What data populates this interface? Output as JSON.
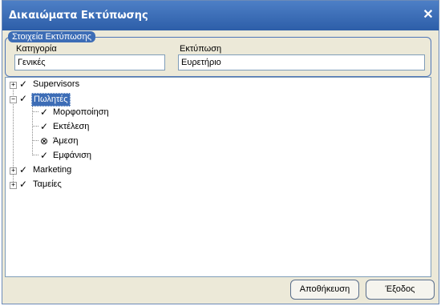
{
  "window": {
    "title": "Δικαιώματα Εκτύπωσης",
    "close_glyph": "✕"
  },
  "group": {
    "legend": "Στοιχεία Εκτύπωσης",
    "category_label": "Κατηγορία",
    "category_value": "Γενικές",
    "print_label": "Εκτύπωση",
    "print_value": "Ευρετήριο"
  },
  "tree": {
    "supervisors": "Supervisors",
    "sales": "Πωλητές",
    "child_format": "Μορφοποίηση",
    "child_execute": "Εκτέλεση",
    "child_direct": "Άμεση",
    "child_display": "Εμφάνιση",
    "marketing": "Marketing",
    "cashiers": "Ταμείες",
    "plus": "+",
    "minus": "−",
    "check": "✓",
    "xmark": "⊗"
  },
  "buttons": {
    "save": "Αποθήκευση",
    "exit": "Έξοδος"
  }
}
